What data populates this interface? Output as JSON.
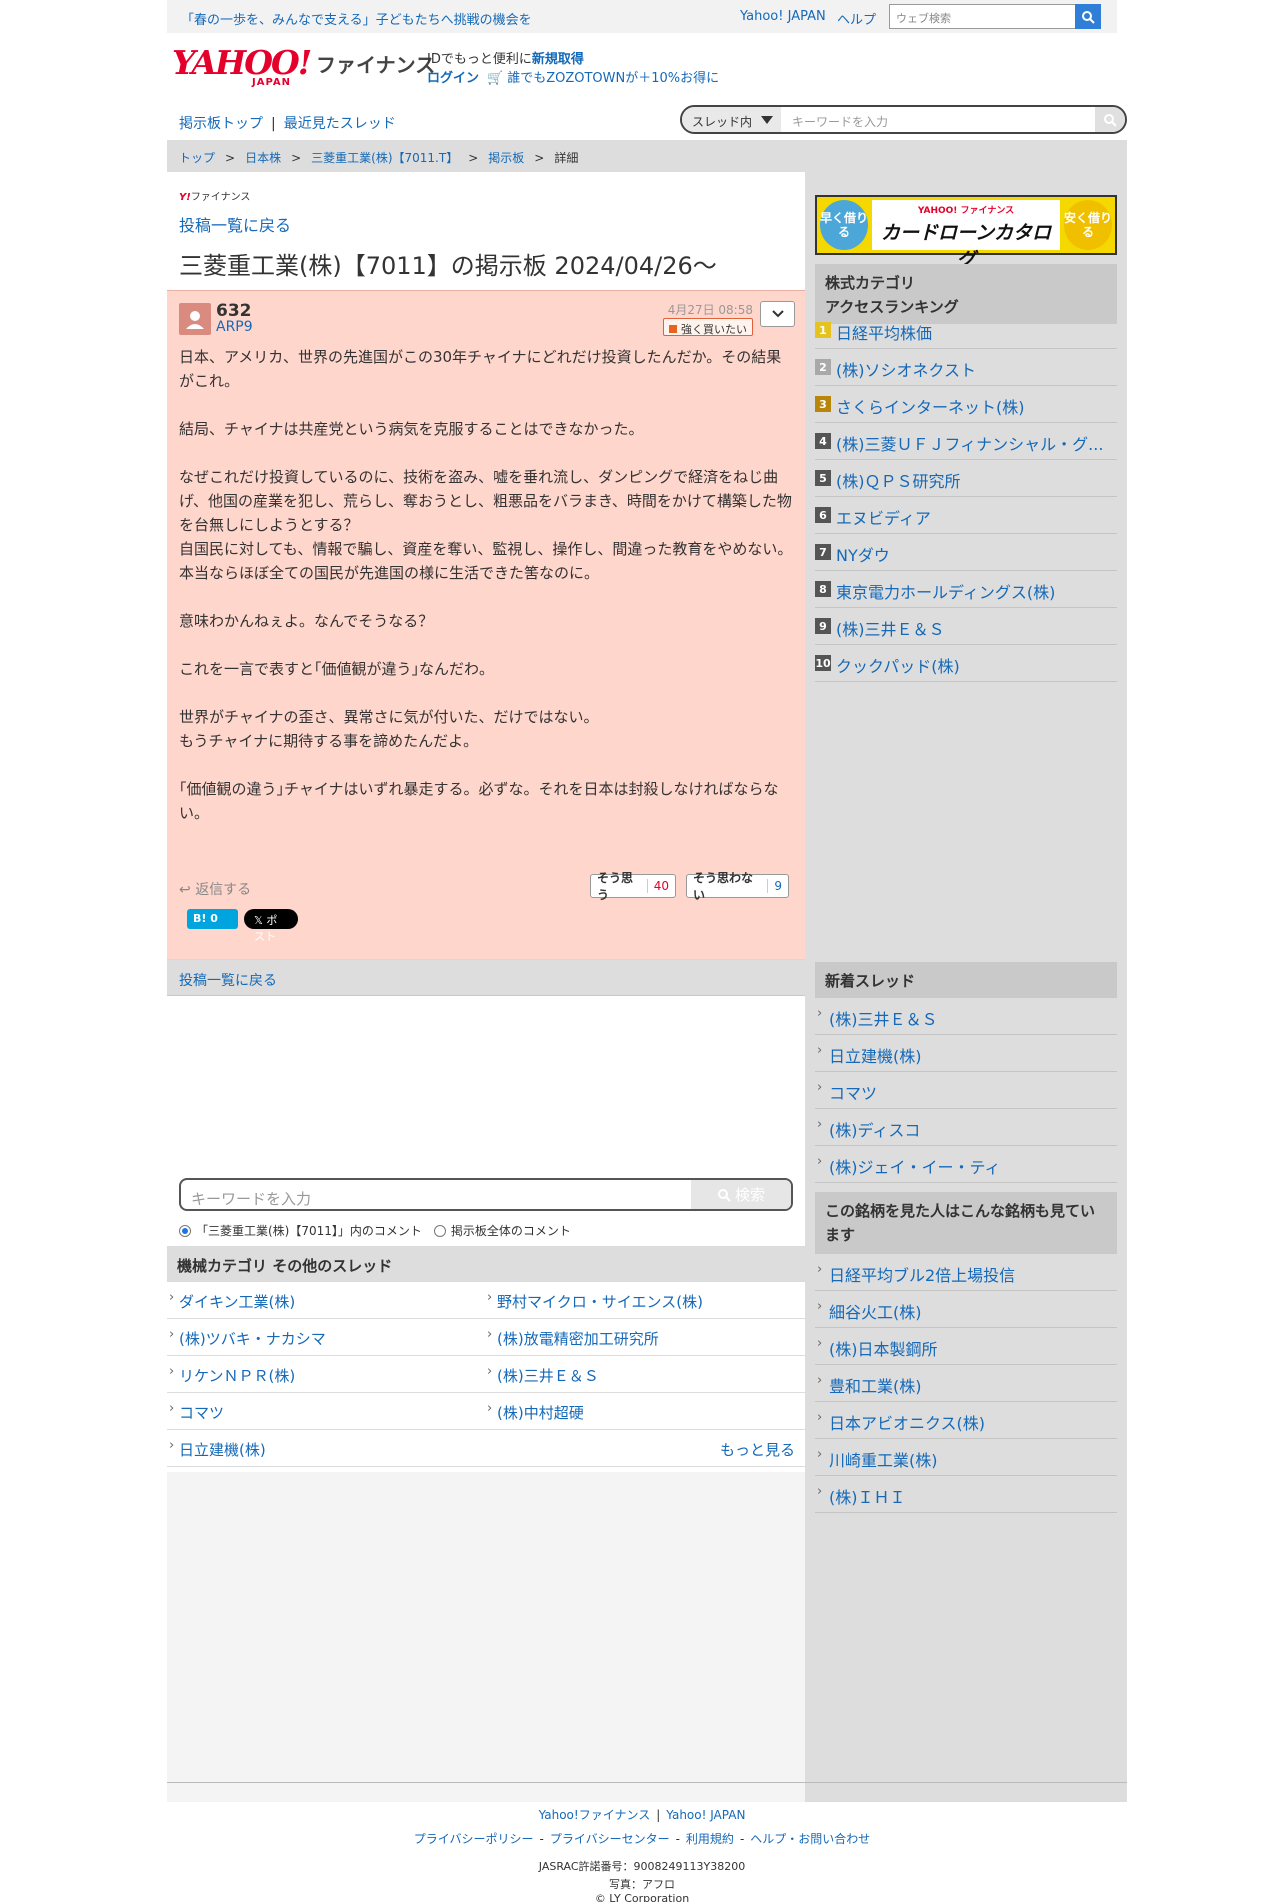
{
  "topbar": {
    "promo": "「春の一歩を、みんなで支える」子どもたちへ挑戦の機会を",
    "yahoo_japan": "Yahoo! JAPAN",
    "help": "ヘルプ",
    "web_search_placeholder": "ウェブ検索"
  },
  "header": {
    "logo_text": "YAHOO!",
    "logo_sub": "JAPAN",
    "service": "ファイナンス",
    "id_prefix": "IDでもっと便利に",
    "id_link": "新規取得",
    "login": "ログイン",
    "zozo": "誰でもZOZOTOWNが＋10%お得に"
  },
  "nav": {
    "board_top": "掲示板トップ",
    "sep": "|",
    "recent": "最近見たスレッド",
    "scope": "スレッド内",
    "keyword_placeholder": "キーワードを入力"
  },
  "breadcrumb": {
    "items": [
      "トップ",
      "日本株",
      "三菱重工業(株)【7011.T】",
      "掲示板"
    ],
    "current": "詳細",
    "sep": ">"
  },
  "main": {
    "mini_logo_mark": "Y!",
    "mini_logo_text": "ファイナンス",
    "back_to_list": "投稿一覧に戻る",
    "title": "三菱重工業(株)【7011】の掲示板 2024/04/26〜"
  },
  "post": {
    "number": "632",
    "user": "ARP9",
    "date": "4月27日 08:58",
    "sentiment": "強く買いたい",
    "paragraphs": [
      "日本、アメリカ、世界の先進国がこの30年チャイナにどれだけ投資したんだか。その結果がこれ。",
      "",
      "結局、チャイナは共産党という病気を克服することはできなかった。",
      "",
      "なぜこれだけ投資しているのに、技術を盗み、嘘を垂れ流し、ダンピングで経済をねじ曲げ、他国の産業を犯し、荒らし、奪おうとし、粗悪品をバラまき、時間をかけて構築した物を台無しにしようとする？",
      "自国民に対しても、情報で騙し、資産を奪い、監視し、操作し、間違った教育をやめない。",
      "本当ならほぼ全ての国民が先進国の様に生活できた筈なのに。",
      "",
      "意味わかんねぇよ。なんでそうなる？",
      "",
      "これを一言で表すと｢価値観が違う｣なんだわ。",
      "",
      "世界がチャイナの歪さ、異常さに気が付いた、だけではない。",
      "もうチャイナに期待する事を諦めたんだよ。",
      "",
      "｢価値観の違う｣チャイナはいずれ暴走する。必ずな。それを日本は封殺しなければならない。"
    ],
    "reply": "返信する",
    "agree_label": "そう思う",
    "agree_count": "40",
    "disagree_label": "そう思わない",
    "disagree_count": "9",
    "hatena_label": "B!",
    "hatena_count": "0",
    "x_label": "ポスト"
  },
  "back_bar": "投稿一覧に戻る",
  "keyword_search": {
    "placeholder": "キーワードを入力",
    "button": "検索",
    "option1": "「三菱重工業(株)【7011】」内のコメント",
    "option2": "掲示板全体のコメント"
  },
  "other_threads": {
    "heading": "機械カテゴリ  その他のスレッド",
    "rows": [
      [
        "ダイキン工業(株)",
        "野村マイクロ・サイエンス(株)"
      ],
      [
        "(株)ツバキ・ナカシマ",
        "(株)放電精密加工研究所"
      ],
      [
        "リケンＮＰＲ(株)",
        "(株)三井Ｅ＆Ｓ"
      ],
      [
        "コマツ",
        "(株)中村超硬"
      ]
    ],
    "last_item": "日立建機(株)",
    "more": "もっと見る"
  },
  "sidebar": {
    "banner_left": "早く借りる",
    "banner_right": "安く借りる",
    "banner_top": "YAHOO! ファイナンス",
    "banner_main": "カードローンカタログ",
    "ranking_heading": "株式カテゴリ\nアクセスランキング",
    "ranking": [
      {
        "rank": "1",
        "name": "日経平均株価",
        "color": "#e6c21f"
      },
      {
        "rank": "2",
        "name": "(株)ソシオネクスト",
        "color": "#a9a9a9"
      },
      {
        "rank": "3",
        "name": "さくらインターネット(株)",
        "color": "#b8860b"
      },
      {
        "rank": "4",
        "name": "(株)三菱ＵＦＪフィナンシャル・グ...",
        "color": "#555555"
      },
      {
        "rank": "5",
        "name": "(株)ＱＰＳ研究所",
        "color": "#555555"
      },
      {
        "rank": "6",
        "name": "エヌビディア",
        "color": "#555555"
      },
      {
        "rank": "7",
        "name": "NYダウ",
        "color": "#555555"
      },
      {
        "rank": "8",
        "name": "東京電力ホールディングス(株)",
        "color": "#555555"
      },
      {
        "rank": "9",
        "name": "(株)三井Ｅ＆Ｓ",
        "color": "#555555"
      },
      {
        "rank": "10",
        "name": "クックパッド(株)",
        "color": "#555555"
      }
    ],
    "new_heading": "新着スレッド",
    "new_threads": [
      "(株)三井Ｅ＆Ｓ",
      "日立建機(株)",
      "コマツ",
      "(株)ディスコ",
      "(株)ジェイ・イー・ティ"
    ],
    "also_heading": "この銘柄を見た人はこんな銘柄も見ています",
    "also_seen": [
      "日経平均ブル2倍上場投信",
      "細谷火工(株)",
      "(株)日本製鋼所",
      "豊和工業(株)",
      "日本アビオニクス(株)",
      "川崎重工業(株)",
      "(株)ＩＨＩ"
    ]
  },
  "footer": {
    "link1": "Yahoo!ファイナンス",
    "link2": "Yahoo! JAPAN",
    "privacy": "プライバシーポリシー",
    "privacy_center": "プライバシーセンター",
    "terms": "利用規約",
    "help": "ヘルプ・お問い合わせ",
    "jasrac": "JASRAC許諾番号：9008249113Y38200",
    "photo": "写真：アフロ",
    "copyright": "© LY Corporation"
  }
}
